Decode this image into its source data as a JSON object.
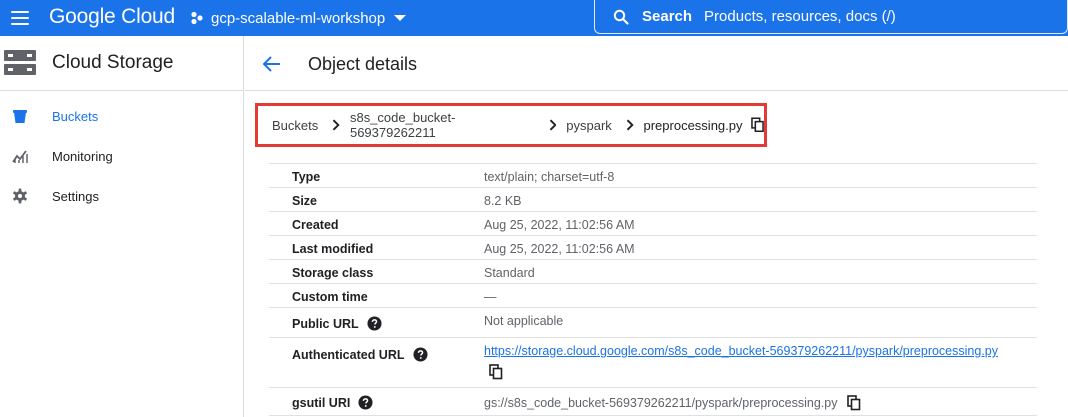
{
  "topbar": {
    "logo": "Google Cloud",
    "project": "gcp-scalable-ml-workshop",
    "search_label": "Search",
    "search_placeholder": "Products, resources, docs (/)"
  },
  "sidebar": {
    "product": "Cloud Storage",
    "items": [
      {
        "label": "Buckets",
        "icon": "bucket-icon",
        "active": true
      },
      {
        "label": "Monitoring",
        "icon": "monitoring-icon",
        "active": false
      },
      {
        "label": "Settings",
        "icon": "gear-icon",
        "active": false
      }
    ]
  },
  "header": {
    "title": "Object details"
  },
  "breadcrumb": [
    "Buckets",
    "s8s_code_bucket-569379262211",
    "pyspark",
    "preprocessing.py"
  ],
  "details": {
    "type": {
      "label": "Type",
      "value": "text/plain; charset=utf-8"
    },
    "size": {
      "label": "Size",
      "value": "8.2 KB"
    },
    "created": {
      "label": "Created",
      "value": "Aug 25, 2022, 11:02:56 AM"
    },
    "modified": {
      "label": "Last modified",
      "value": "Aug 25, 2022, 11:02:56 AM"
    },
    "storage_class": {
      "label": "Storage class",
      "value": "Standard"
    },
    "custom_time": {
      "label": "Custom time",
      "value": "—"
    },
    "public_url": {
      "label": "Public URL",
      "value": "Not applicable"
    },
    "auth_url": {
      "label": "Authenticated URL",
      "value": "https://storage.cloud.google.com/s8s_code_bucket-569379262211/pyspark/preprocessing.py"
    },
    "gsutil": {
      "label": "gsutil URI",
      "value": "gs://s8s_code_bucket-569379262211/pyspark/preprocessing.py"
    }
  },
  "colors": {
    "brand": "#1a73e8",
    "highlight": "#e53935"
  }
}
